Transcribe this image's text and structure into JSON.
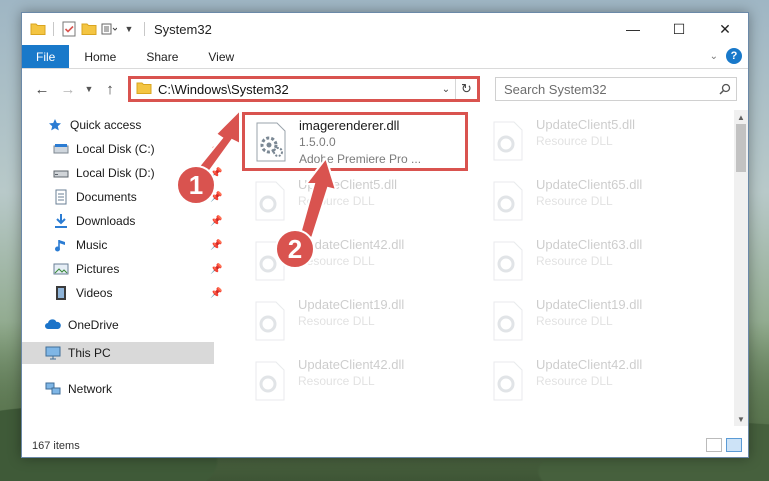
{
  "window": {
    "title": "System32",
    "controls": {
      "minimize": "—",
      "maximize": "☐",
      "close": "✕"
    }
  },
  "ribbon": {
    "tabs": [
      "File",
      "Home",
      "Share",
      "View"
    ]
  },
  "address": {
    "path": "C:\\Windows\\System32"
  },
  "search": {
    "placeholder": "Search System32"
  },
  "sidebar": {
    "items": [
      {
        "label": "Quick access",
        "icon": "star-icon",
        "pinned": false
      },
      {
        "label": "Local Disk (C:)",
        "icon": "drive-icon",
        "pinned": true
      },
      {
        "label": "Local Disk (D:)",
        "icon": "drive-icon",
        "pinned": true
      },
      {
        "label": "Documents",
        "icon": "documents-icon",
        "pinned": true
      },
      {
        "label": "Downloads",
        "icon": "download-icon",
        "pinned": true
      },
      {
        "label": "Music",
        "icon": "music-icon",
        "pinned": true
      },
      {
        "label": "Pictures",
        "icon": "pictures-icon",
        "pinned": true
      },
      {
        "label": "Videos",
        "icon": "videos-icon",
        "pinned": true
      },
      {
        "label": "OneDrive",
        "icon": "cloud-icon",
        "pinned": false
      },
      {
        "label": "This PC",
        "icon": "computer-icon",
        "pinned": false,
        "selected": true
      },
      {
        "label": "Network",
        "icon": "network-icon",
        "pinned": false
      }
    ]
  },
  "files": [
    {
      "name": "imagerenderer.dll",
      "line2": "1.5.0.0",
      "line3": "Adobe Premiere Pro ...",
      "highlight": true
    },
    {
      "name": "UpdateClient5.dll",
      "line2": "Resource DLL"
    },
    {
      "name": "UpdateClient5.dll",
      "line2": "Resource DLL"
    },
    {
      "name": "UpdateClient65.dll",
      "line2": "Resource DLL"
    },
    {
      "name": "UpdateClient42.dll",
      "line2": "Resource DLL"
    },
    {
      "name": "UpdateClient63.dll",
      "line2": "Resource DLL"
    },
    {
      "name": "UpdateClient19.dll",
      "line2": "Resource DLL"
    },
    {
      "name": "UpdateClient19.dll",
      "line2": "Resource DLL"
    },
    {
      "name": "UpdateClient42.dll",
      "line2": "Resource DLL"
    },
    {
      "name": "UpdateClient42.dll",
      "line2": "Resource DLL"
    }
  ],
  "status": {
    "item_count": "167 items"
  },
  "annotations": {
    "step1": "1",
    "step2": "2",
    "color": "#d9534f"
  }
}
